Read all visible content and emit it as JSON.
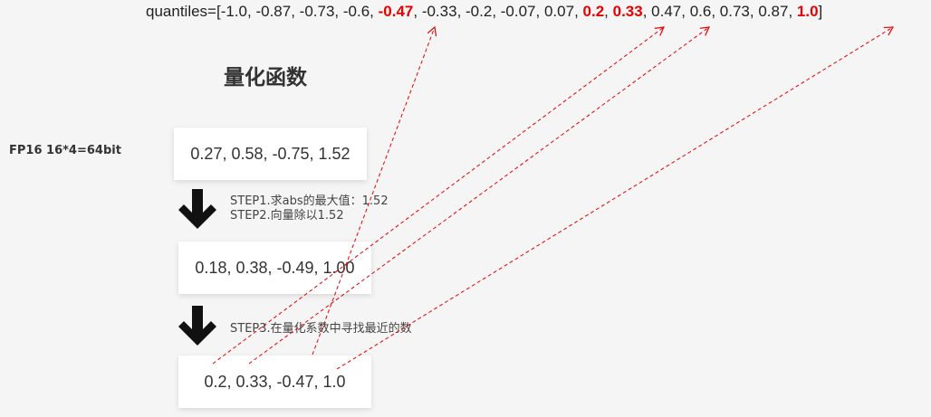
{
  "quantiles": {
    "prefix": "quantiles=[",
    "suffix": "]",
    "separator": ", ",
    "values": [
      "-1.0",
      "-0.87",
      "-0.73",
      "-0.6",
      "-0.47",
      "-0.33",
      "-0.2",
      "-0.07",
      "0.07",
      "0.2",
      "0.33",
      "0.47",
      "0.6",
      "0.73",
      "0.87",
      "1.0"
    ],
    "highlighted_values": [
      "-0.47",
      "0.2",
      "0.33",
      "1.0"
    ],
    "highlight_color": "#e60000"
  },
  "title": "量化函数",
  "fp_label": "FP16 16*4=64bit",
  "boxes": {
    "original": "0.27, 0.58, -0.75, 1.52",
    "normalized": "0.18, 0.38, -0.49, 1.00",
    "quantized": "0.2, 0.33, -0.47, 1.0"
  },
  "steps": {
    "step1": "STEP1.求abs的最大值：1.52",
    "step2": "STEP2.向量除以1.52",
    "step3": "STEP3.在量化系数中寻找最近的数"
  },
  "arrow_color": "#e60000"
}
